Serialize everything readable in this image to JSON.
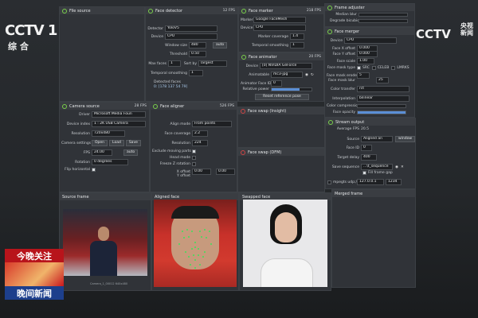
{
  "broadcast": {
    "logo_left": "CCTV 1",
    "logo_left_sub": "综 合",
    "logo_right": "CCTV",
    "logo_right_cn": "央视",
    "logo_right_sub": "新闻",
    "badge_top": "今晚关注",
    "badge_bottom": "晚间新闻"
  },
  "file_source": {
    "title": "File source"
  },
  "face_detector": {
    "title": "Face detector",
    "fps": "12 FPS",
    "detector_label": "Detector",
    "detector": "YoloV5",
    "device_label": "Device",
    "device": "CPU",
    "window_size_label": "Window size",
    "window_size": "480",
    "window_auto": "auto",
    "threshold_label": "Threshold",
    "threshold": "0.50",
    "max_faces_label": "Max faces",
    "max_faces": "1",
    "sort_by_label": "Sort by",
    "sort_by": "largest",
    "temporal_label": "Temporal smoothing",
    "temporal": "1",
    "detected_label": "Detected faces",
    "detected": "0: [178 137 54 79]"
  },
  "face_marker": {
    "title": "Face marker",
    "fps": "218 FPS",
    "marker_label": "Marker",
    "marker": "Google FaceMesh",
    "device_label": "Device",
    "device": "CPU",
    "coverage_label": "Marker coverage",
    "coverage": "1.4",
    "temporal_label": "Temporal smoothing",
    "temporal": "1"
  },
  "face_animator": {
    "title": "Face animator",
    "fps": "20 FPS",
    "device_label": "Device",
    "device": "[0] NVIDIA GeForce",
    "animatable_label": "Animatable",
    "animatable": "mc3-jpg",
    "face_id_label": "Animator Face ID",
    "face_id": "0",
    "relative_label": "Relative power",
    "reset_label": "Reset reference pose"
  },
  "frame_adjuster": {
    "title": "Frame adjuster",
    "median_label": "Median blur",
    "degrade_label": "Degrade bicubic"
  },
  "face_merger": {
    "title": "Face merger",
    "device_label": "Device",
    "device": "CPU",
    "x_offset_label": "Face X offset",
    "x_offset": "0.000",
    "y_offset_label": "Face Y offset",
    "y_offset": "0.000",
    "scale_label": "Face scale",
    "scale": "1.00",
    "mask_type_label": "Face mask type",
    "mask_src": "SRC",
    "mask_celeb": "CELEB",
    "mask_lmrks": "LMRKS",
    "erode_label": "Face mask erode",
    "erode": "5",
    "blur_label": "Face mask blur",
    "blur": "25",
    "color_transfer_label": "Color transfer",
    "color_transfer": "rct",
    "interp_label": "Interpolation",
    "interp": "bilinear",
    "compression_label": "Color compression",
    "opacity_label": "Face opacity"
  },
  "camera_source": {
    "title": "Camera source",
    "fps": "28 FPS",
    "driver_label": "Driver",
    "driver": "Microsoft Media Foun",
    "device_index_label": "Device index",
    "device_index": "1 : 2K USB Camera",
    "resolution_label": "Resolution",
    "resolution": "720x480",
    "settings_label": "Camera settings",
    "open": "Open",
    "load": "Load",
    "save": "Save",
    "fps_label": "FPS",
    "fps_value": "24.00",
    "fps_auto": "auto",
    "rotation_label": "Rotation",
    "rotation": "0 degrees",
    "flip_label": "Flip horizontal"
  },
  "face_aligner": {
    "title": "Face aligner",
    "fps": "526 FPS",
    "align_mode_label": "Align mode",
    "align_mode": "From points",
    "coverage_label": "Face coverage",
    "coverage": "2.2",
    "resolution_label": "Resolution",
    "resolution": "224",
    "exclude_label": "Exclude moving parts",
    "head_mode_label": "Head mode",
    "freeze_label": "Freeze Z rotation",
    "x_offset_label": "X offset",
    "x_offset": "0.00",
    "y_offset_label": "Y offset",
    "y_offset": "0.00"
  },
  "face_swap_insight": {
    "title": "Face swap (Insight)"
  },
  "face_swap_dfm": {
    "title": "Face swap (DFM)"
  },
  "stream_output": {
    "title": "Stream output",
    "avg_fps_label": "Average FPS",
    "avg_fps": "20.5",
    "source_label": "Source",
    "source": "Aligned an",
    "window": "window",
    "face_id_label": "Face ID",
    "face_id": "0",
    "delay_label": "Target delay",
    "delay": "400",
    "save_label": "Save sequence",
    "save_path": "...\\t_sequence",
    "fill_gap_label": "Fill frame gap",
    "mpegts_label": "mpegts udp://",
    "mpegts_host": "127.0.0.1",
    "mpegts_port": "1234"
  },
  "views": {
    "source_frame": "Source frame",
    "aligned_face": "Aligned face",
    "swapped_face": "Swapped face",
    "merged_frame": "Merged frame",
    "source_caption": "Camera_1_00012 640x480"
  }
}
